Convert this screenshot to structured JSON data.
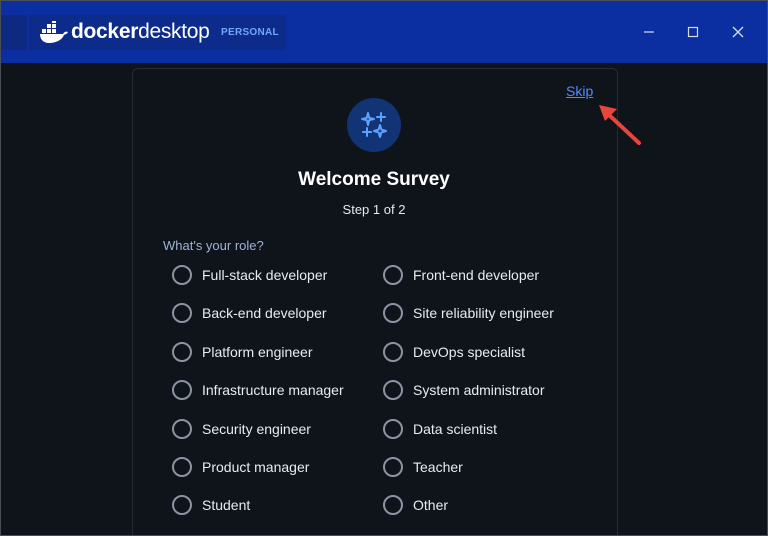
{
  "app": {
    "brand_bold": "docker",
    "brand_light": "desktop",
    "plan_badge": "PERSONAL"
  },
  "window_controls": {
    "minimize_icon": "minimize-icon",
    "maximize_icon": "maximize-icon",
    "close_icon": "close-icon"
  },
  "survey": {
    "skip_label": "Skip",
    "title": "Welcome Survey",
    "step": "Step 1 of 2",
    "question": "What's your role?",
    "options_left": [
      "Full-stack developer",
      "Back-end developer",
      "Platform engineer",
      "Infrastructure manager",
      "Security engineer",
      "Product manager",
      "Student"
    ],
    "options_right": [
      "Front-end developer",
      "Site reliability engineer",
      "DevOps specialist",
      "System administrator",
      "Data scientist",
      "Teacher",
      "Other"
    ]
  },
  "colors": {
    "titlebar": "#0b2fa0",
    "accent": "#4d8dff",
    "background": "#0f141b",
    "annotation_arrow": "#e8453c"
  }
}
